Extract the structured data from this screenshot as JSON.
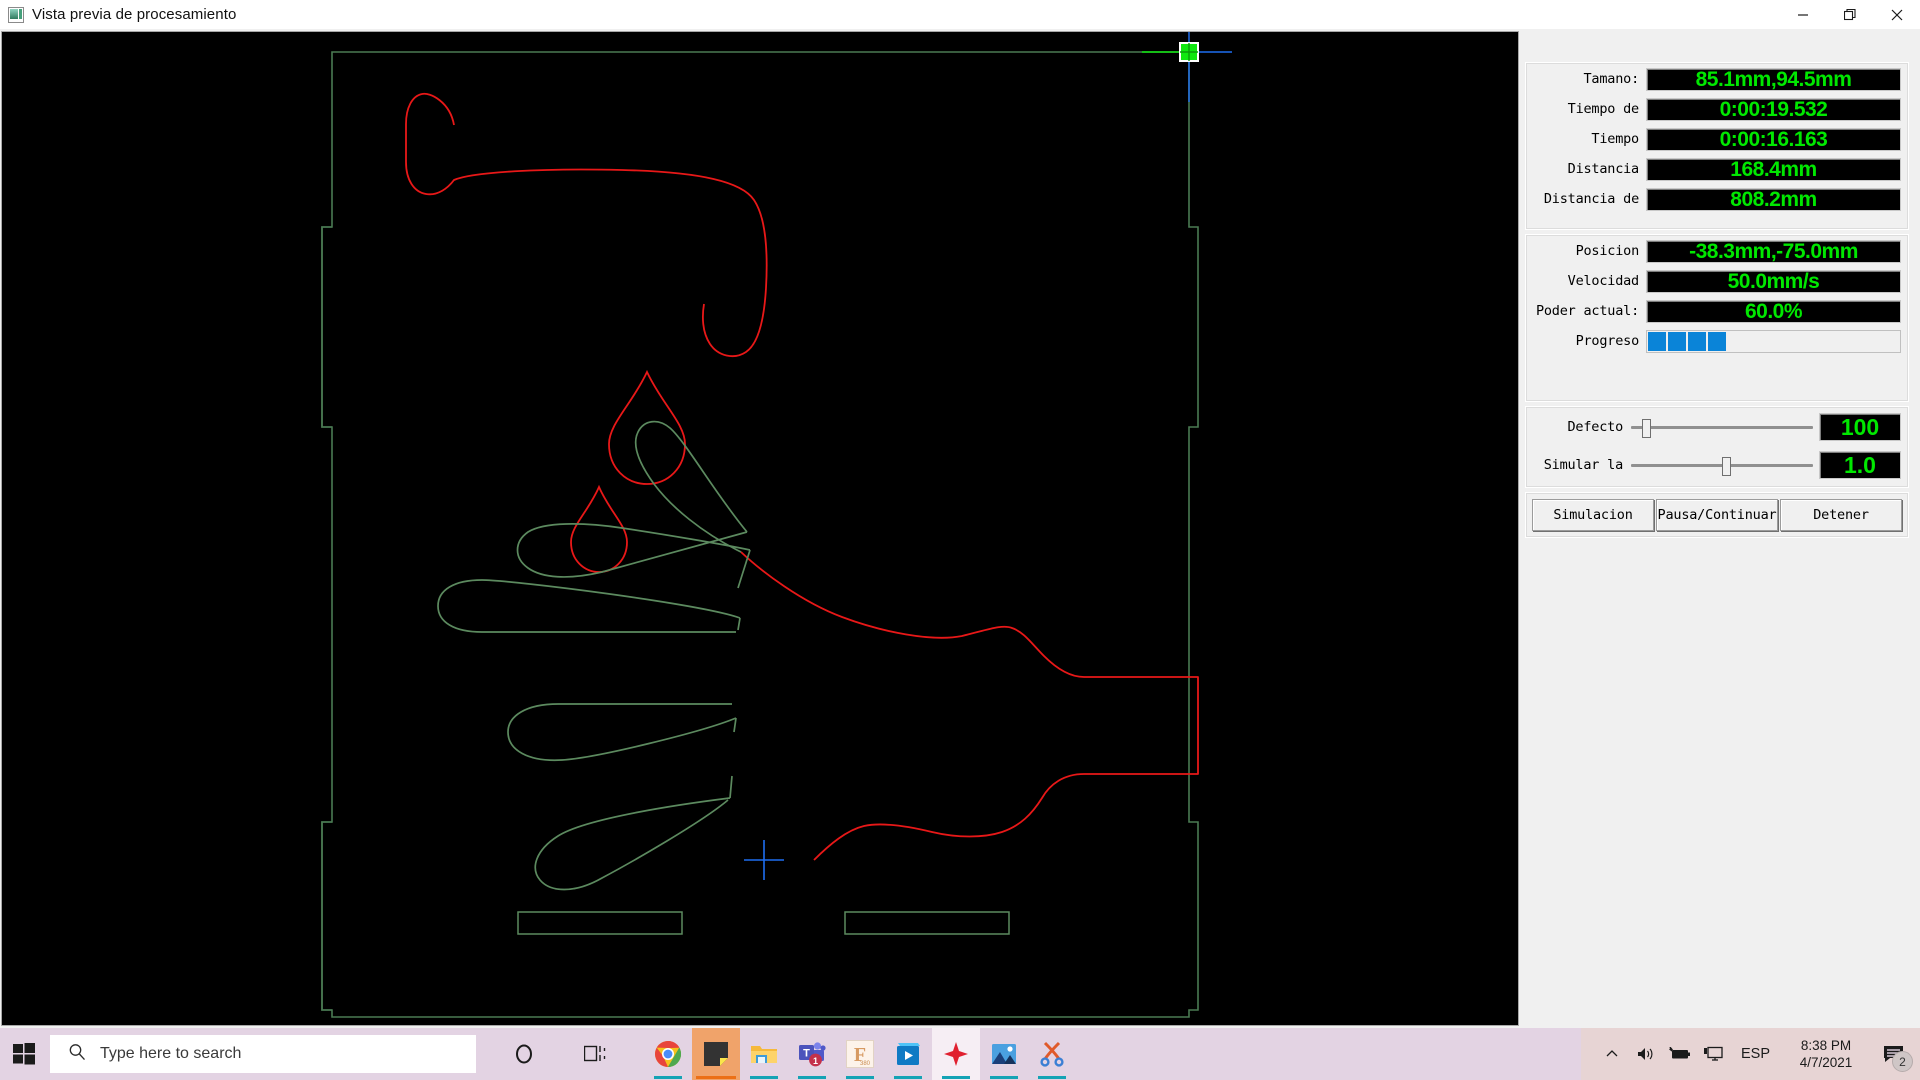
{
  "window": {
    "title": "Vista previa de procesamiento",
    "icon": "preview-image-icon",
    "minimize_label": "—",
    "restore_label": "❐",
    "close_label": "✕"
  },
  "panel": {
    "info": {
      "rows": [
        {
          "label": "Tamano:",
          "value": "85.1mm,94.5mm"
        },
        {
          "label": "Tiempo de",
          "value": "0:00:19.532"
        },
        {
          "label": "Tiempo",
          "value": "0:00:16.163"
        },
        {
          "label": "Distancia",
          "value": "168.4mm"
        },
        {
          "label": "Distancia de",
          "value": "808.2mm"
        }
      ]
    },
    "status": {
      "rows": [
        {
          "label": "Posicion",
          "value": "-38.3mm,-75.0mm"
        },
        {
          "label": "Velocidad",
          "value": "50.0mm/s"
        },
        {
          "label": "Poder actual:",
          "value": "60.0%"
        }
      ],
      "progress_label": "Progreso",
      "progress_blocks": 4
    },
    "sliders": [
      {
        "label": "Defecto",
        "value": "100",
        "pos_pct": 6
      },
      {
        "label": "Simular la",
        "value": "1.0",
        "pos_pct": 50
      }
    ],
    "buttons": [
      {
        "label": "Simulacion"
      },
      {
        "label": "Pausa/Continuar"
      },
      {
        "label": "Detener"
      }
    ]
  },
  "canvas": {
    "background": "#000000",
    "frame_color": "#4a7a52",
    "pending_color": "#e81818",
    "done_color": "#5c8a5f",
    "handle_color": "#10e810",
    "crosshair_color": "#1e6ef0",
    "laser_crosshair_color": "#1e6ef0"
  },
  "taskbar": {
    "search_placeholder": "Type here to search",
    "start_icon": "windows-start-icon",
    "search_icon": "search-icon",
    "apps": [
      {
        "name": "cortana-icon"
      },
      {
        "name": "task-view-icon"
      },
      {
        "name": "chrome-icon"
      },
      {
        "name": "sticky-notes-icon"
      },
      {
        "name": "file-explorer-icon"
      },
      {
        "name": "microsoft-teams-icon",
        "badge": "1"
      },
      {
        "name": "fontbase-icon",
        "sub": "380"
      },
      {
        "name": "movies-tv-icon"
      },
      {
        "name": "lightburn-icon"
      },
      {
        "name": "photos-icon"
      },
      {
        "name": "snip-sketch-icon"
      }
    ],
    "tray": {
      "chevron_icon": "chevron-up-icon",
      "volume_icon": "volume-icon",
      "battery_icon": "battery-charging-icon",
      "network_icon": "network-display-icon",
      "language": "ESP",
      "time": "8:38 PM",
      "date": "4/7/2021",
      "notifications_icon": "notifications-icon",
      "notifications_count": "2"
    }
  }
}
